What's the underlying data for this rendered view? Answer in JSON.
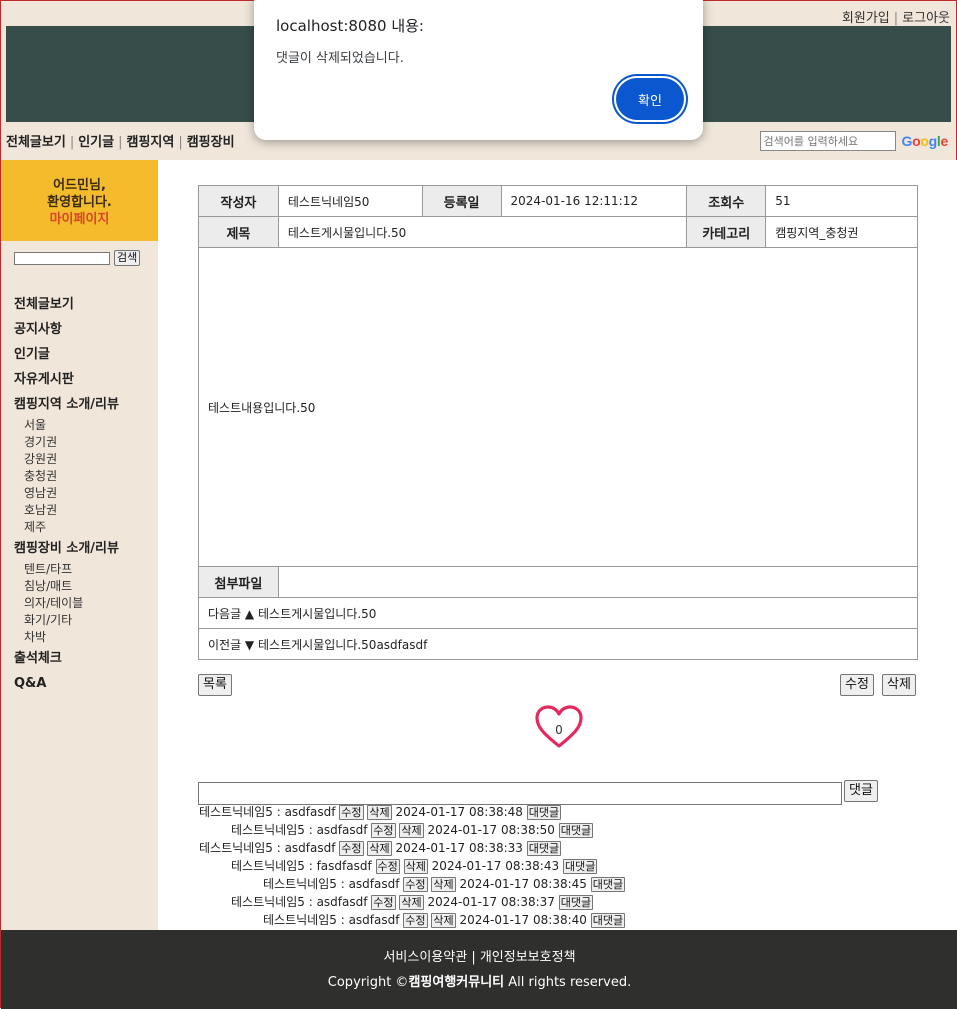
{
  "top_links": [
    "회원가입",
    "로그아웃"
  ],
  "main_nav": [
    "전체글보기",
    "인기글",
    "캠핑지역",
    "캠핑장비"
  ],
  "search": {
    "placeholder": "검색어를 입력하세요",
    "logo": "Google"
  },
  "sidebar": {
    "welcome_line1": "어드민님,",
    "welcome_line2": "환영합니다.",
    "mypage": "마이페이지",
    "search_button": "검색",
    "menu": [
      {
        "label": "전체글보기",
        "sub": []
      },
      {
        "label": "공지사항",
        "sub": []
      },
      {
        "label": "인기글",
        "sub": []
      },
      {
        "label": "자유게시판",
        "sub": []
      },
      {
        "label": "캠핑지역 소개/리뷰",
        "sub": [
          "서울",
          "경기권",
          "강원권",
          "충청권",
          "영남권",
          "호남권",
          "제주"
        ]
      },
      {
        "label": "캠핑장비 소개/리뷰",
        "sub": [
          "텐트/타프",
          "침낭/매트",
          "의자/테이블",
          "화기/기타",
          "차박"
        ]
      },
      {
        "label": "출석체크",
        "sub": []
      },
      {
        "label": "Q&A",
        "sub": []
      }
    ]
  },
  "post": {
    "author_label": "작성자",
    "author": "테스트닉네임50",
    "date_label": "등록일",
    "date": "2024-01-16 12:11:12",
    "views_label": "조회수",
    "views": "51",
    "title_label": "제목",
    "title": "테스트게시물입니다.50",
    "category_label": "카테고리",
    "category": "캠핑지역_충청권",
    "body": "테스트내용입니다.50",
    "attachment_label": "첨부파일",
    "attachment": "",
    "next_label": "다음글 ▲",
    "next_title": "테스트게시물입니다.50",
    "prev_label": "이전글 ▼",
    "prev_title": "테스트게시물입니다.50asdfasdf"
  },
  "buttons": {
    "list": "목록",
    "edit": "수정",
    "delete": "삭제",
    "comment": "댓글"
  },
  "likes": {
    "count": "0",
    "color": "#e5295f"
  },
  "comments": [
    {
      "depth": 0,
      "author": "테스트닉네임5",
      "text": "asdfasdf",
      "date": "2024-01-17 08:38:48"
    },
    {
      "depth": 1,
      "author": "테스트닉네임5",
      "text": "asdfasdf",
      "date": "2024-01-17 08:38:50"
    },
    {
      "depth": 0,
      "author": "테스트닉네임5",
      "text": "asdfasdf",
      "date": "2024-01-17 08:38:33"
    },
    {
      "depth": 1,
      "author": "테스트닉네임5",
      "text": "fasdfasdf",
      "date": "2024-01-17 08:38:43"
    },
    {
      "depth": 2,
      "author": "테스트닉네임5",
      "text": "asdfasdf",
      "date": "2024-01-17 08:38:45"
    },
    {
      "depth": 1,
      "author": "테스트닉네임5",
      "text": "asdfasdf",
      "date": "2024-01-17 08:38:37"
    },
    {
      "depth": 2,
      "author": "테스트닉네임5",
      "text": "asdfasdf",
      "date": "2024-01-17 08:38:40"
    }
  ],
  "comment_buttons": {
    "edit": "수정",
    "delete": "삭제",
    "reply": "대댓글"
  },
  "footer": {
    "links": [
      "서비스이용약관",
      "개인정보보호정책"
    ],
    "copyright_prefix": "Copyright ©",
    "brand": "캠핑여행커뮤니티",
    "copyright_suffix": "All rights reserved."
  },
  "dialog": {
    "title": "localhost:8080 내용:",
    "message": "댓글이 삭제되었습니다.",
    "ok": "확인"
  },
  "colors": {
    "banner": "#374d4a",
    "welcome_bg": "#f4bb2d",
    "page_bg": "#f0e6da",
    "footer_bg": "#2f2f2e",
    "dialog_button": "#0b57d0"
  }
}
